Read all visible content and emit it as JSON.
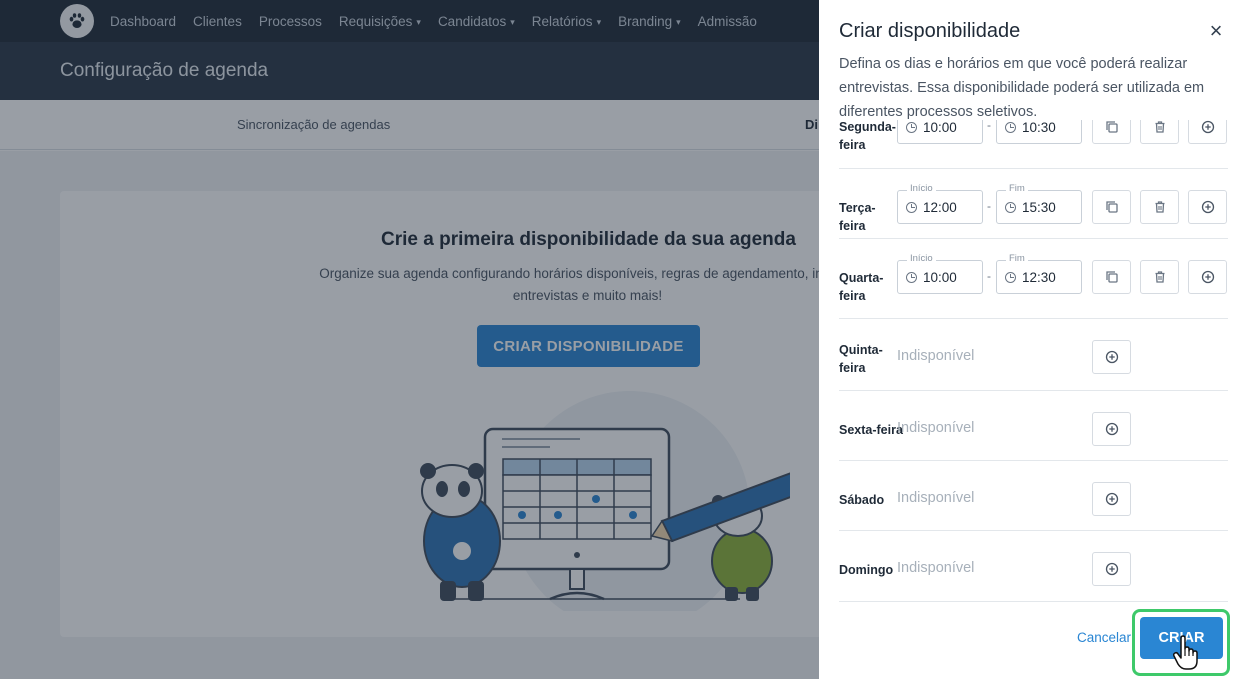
{
  "nav": {
    "items": [
      {
        "label": "Dashboard",
        "dropdown": false
      },
      {
        "label": "Clientes",
        "dropdown": false
      },
      {
        "label": "Processos",
        "dropdown": false
      },
      {
        "label": "Requisições",
        "dropdown": true
      },
      {
        "label": "Candidatos",
        "dropdown": true
      },
      {
        "label": "Relatórios",
        "dropdown": true
      },
      {
        "label": "Branding",
        "dropdown": true
      },
      {
        "label": "Admissão",
        "dropdown": false
      }
    ]
  },
  "page": {
    "title": "Configuração de agenda",
    "tabs": [
      "Sincronização de agendas",
      "Di"
    ]
  },
  "empty_state": {
    "heading": "Crie a primeira disponibilidade da sua agenda",
    "description_line1": "Organize sua agenda configurando horários disponíveis, regras de agendamento, interval",
    "description_line2": "entrevistas e muito mais!",
    "cta": "CRIAR DISPONIBILIDADE"
  },
  "drawer": {
    "title": "Criar disponibilidade",
    "close_icon": "close-icon",
    "intro": "Defina os dias e horários em que você poderá realizar entrevistas. Essa disponibilidade poderá ser utilizada em diferentes processos seletivos.",
    "start_label": "Início",
    "end_label": "Fim",
    "unavailable_label": "Indisponível",
    "days": [
      {
        "name_l1": "Segunda-",
        "name_l2": "feira",
        "start": "10:00",
        "end": "10:30"
      },
      {
        "name_l1": "Terça-feira",
        "name_l2": "",
        "start": "12:00",
        "end": "15:30"
      },
      {
        "name_l1": "Quarta-",
        "name_l2": "feira",
        "start": "10:00",
        "end": "12:30"
      },
      {
        "name_l1": "Quinta-",
        "name_l2": "feira"
      },
      {
        "name_l1": "Sexta-feira",
        "name_l2": ""
      },
      {
        "name_l1": "Sábado",
        "name_l2": ""
      },
      {
        "name_l1": "Domingo",
        "name_l2": ""
      }
    ],
    "cancel_label": "Cancelar",
    "create_label": "CRIAR"
  },
  "colors": {
    "primary": "#2a86d3",
    "nav_bg": "#1f2a37",
    "highlight": "#3ec96a"
  }
}
